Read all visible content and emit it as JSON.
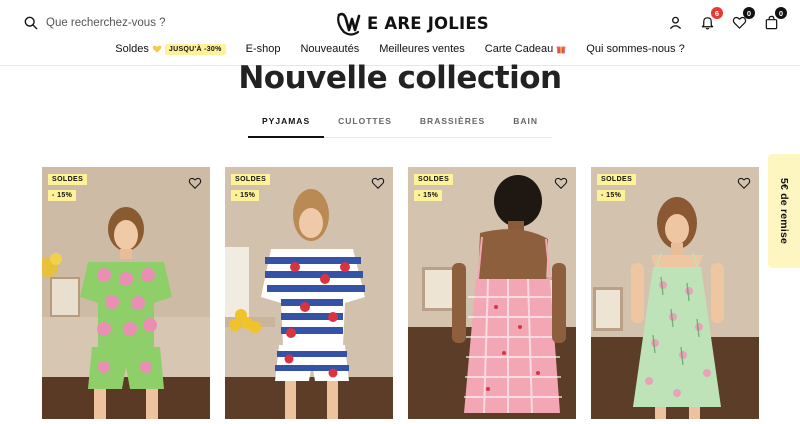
{
  "search": {
    "placeholder": "Que recherchez-vous ?"
  },
  "brand": {
    "name": "WE ARE JOLIES",
    "logo_text": "E ARE JOLIES"
  },
  "header_icons": {
    "notifications_count": "6",
    "wishlist_count": "0",
    "cart_count": "0"
  },
  "nav": {
    "soldes": "Soldes",
    "soldes_pill": "JUSQU'À -30%",
    "eshop": "E-shop",
    "nouveautes": "Nouveautés",
    "meilleures": "Meilleures ventes",
    "carte": "Carte Cadeau",
    "qui": "Qui sommes-nous ?"
  },
  "section": {
    "title": "Nouvelle collection"
  },
  "tabs": [
    {
      "label": "PYJAMAS"
    },
    {
      "label": "CULOTTES"
    },
    {
      "label": "BRASSIÈRES"
    },
    {
      "label": "BAIN"
    }
  ],
  "products": [
    {
      "badge": "SOLDES",
      "discount": "- 15%"
    },
    {
      "badge": "SOLDES",
      "discount": "- 15%"
    },
    {
      "badge": "SOLDES",
      "discount": "- 15%"
    },
    {
      "badge": "SOLDES",
      "discount": "- 15%"
    }
  ],
  "side_tab": {
    "label": "5€ de remise"
  },
  "colors": {
    "accent_yellow": "#fdf29a",
    "badge_red": "#e53935",
    "text": "#111111"
  }
}
